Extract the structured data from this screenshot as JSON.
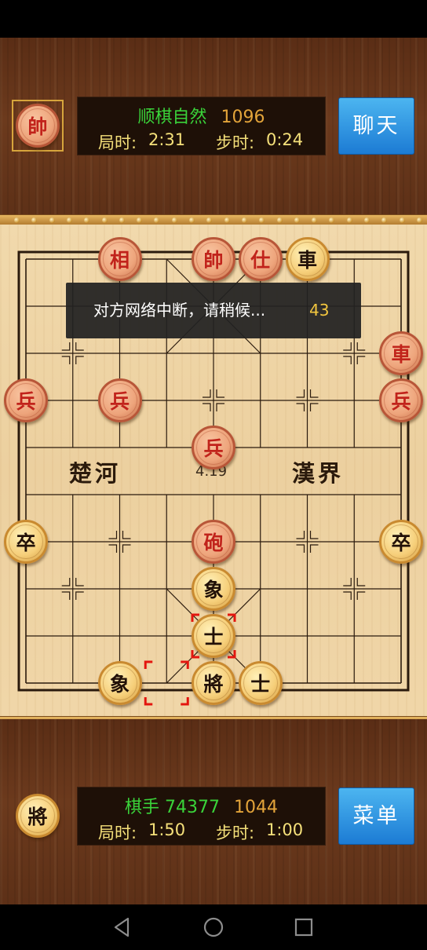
{
  "opponent": {
    "avatar_char": "帥",
    "name": "顺棋自然",
    "rating": "1096",
    "game_time_label": "局时:",
    "game_time": "2:31",
    "step_time_label": "步时:",
    "step_time": "0:24"
  },
  "player": {
    "avatar_char": "將",
    "name": "棋手 74377",
    "rating": "1044",
    "game_time_label": "局时:",
    "game_time": "1:50",
    "step_time_label": "步时:",
    "step_time": "1:00"
  },
  "buttons": {
    "chat": "聊天",
    "menu": "菜单"
  },
  "toast": {
    "message": "对方网络中断，请稍候...",
    "countdown": "43"
  },
  "board": {
    "river_left": "楚河",
    "river_right": "漢界",
    "move_time": "4.19",
    "pieces_red": [
      {
        "char": "相",
        "col": 2,
        "row": 0
      },
      {
        "char": "帥",
        "col": 4,
        "row": 0
      },
      {
        "char": "仕",
        "col": 5,
        "row": 0
      },
      {
        "char": "車",
        "col": 8,
        "row": 2
      },
      {
        "char": "兵",
        "col": 0,
        "row": 3
      },
      {
        "char": "兵",
        "col": 2,
        "row": 3
      },
      {
        "char": "兵",
        "col": 8,
        "row": 3
      },
      {
        "char": "兵",
        "col": 4,
        "row": 4
      },
      {
        "char": "砲",
        "col": 4,
        "row": 6
      }
    ],
    "pieces_black": [
      {
        "char": "車",
        "col": 6,
        "row": 0
      },
      {
        "char": "卒",
        "col": 0,
        "row": 6
      },
      {
        "char": "卒",
        "col": 8,
        "row": 6
      },
      {
        "char": "象",
        "col": 4,
        "row": 7
      },
      {
        "char": "士",
        "col": 4,
        "row": 8
      },
      {
        "char": "象",
        "col": 2,
        "row": 9
      },
      {
        "char": "將",
        "col": 4,
        "row": 9
      },
      {
        "char": "士",
        "col": 5,
        "row": 9
      }
    ],
    "last_move": {
      "from": {
        "col": 3,
        "row": 9
      },
      "to": {
        "col": 4,
        "row": 8
      }
    }
  },
  "colors": {
    "name": "#3ad33a",
    "rating": "#e3a43a",
    "time": "#f5e07a",
    "red_piece": "#c1231b",
    "toast_count": "#f3c73f"
  },
  "nav_icons": [
    "back-icon",
    "home-icon",
    "recents-icon"
  ]
}
